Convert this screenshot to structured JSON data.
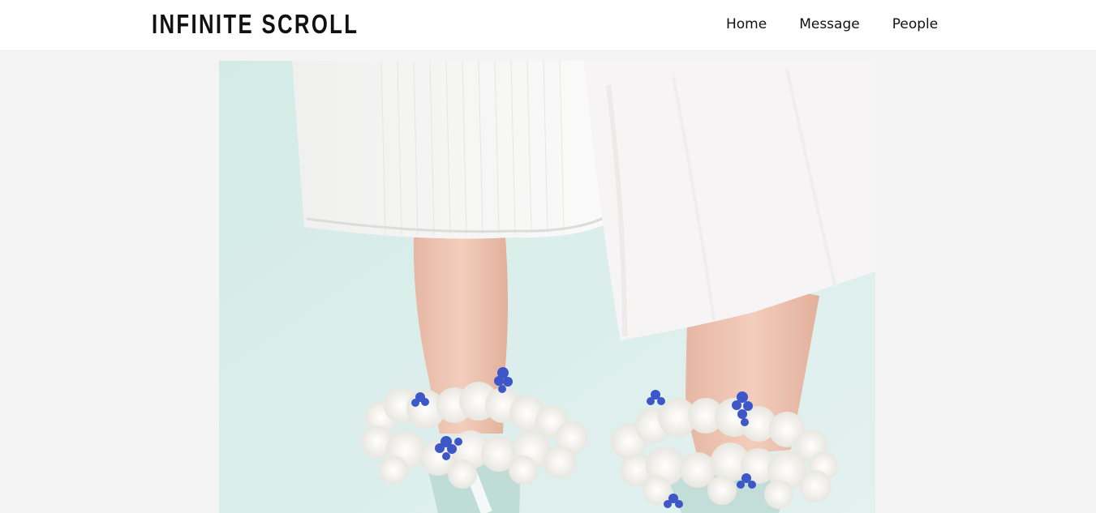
{
  "site": {
    "logo_text": "INFINITE SCROLL"
  },
  "nav": {
    "items": [
      {
        "label": "Home"
      },
      {
        "label": "Message"
      },
      {
        "label": "People"
      }
    ]
  },
  "feed": {
    "image_subject": "legs-with-flower-socks-photo"
  },
  "colors": {
    "header_bg": "#ffffff",
    "page_bg": "#f4f4f4",
    "text": "#111111",
    "photo_bg": "#d9ece8",
    "flower_blue": "#3d57c9"
  }
}
